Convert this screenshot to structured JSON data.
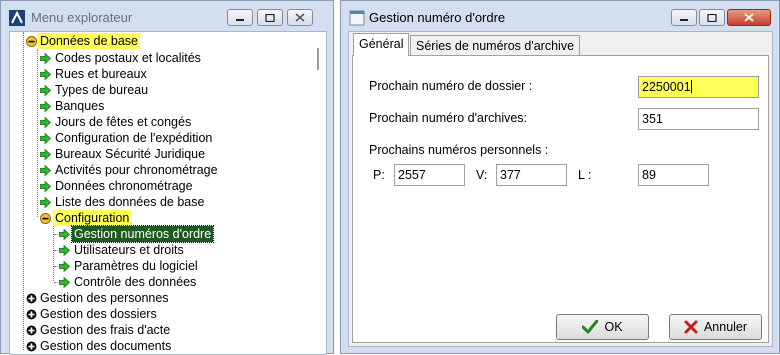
{
  "explorer": {
    "title": "Menu explorateur",
    "tree": {
      "donnees_de_base": "Données de base",
      "children": [
        "Codes postaux et localités",
        "Rues et bureaux",
        "Types de bureau",
        "Banques",
        "Jours de fêtes et congés",
        "Configuration de l'expédition",
        "Bureaux Sécurité Juridique",
        "Activités pour chronométrage",
        "Données chronométrage",
        "Liste des données de base"
      ],
      "configuration": "Configuration",
      "config_children": [
        "Gestion numéros d'ordre",
        "Utilisateurs et droits",
        "Paramètres du logiciel",
        "Contrôle des données"
      ],
      "top_level": [
        "Gestion des personnes",
        "Gestion des dossiers",
        "Gestion des frais d'acte",
        "Gestion des documents"
      ]
    }
  },
  "dialog": {
    "title": "Gestion numéro d'ordre",
    "tabs": [
      "Général",
      "Séries de numéros d'archive"
    ],
    "labels": {
      "dossier": "Prochain numéro de dossier :",
      "archives": "Prochain numéro d'archives:",
      "personnels": "Prochains numéros personnels :",
      "p": "P:",
      "v": "V:",
      "l": "L :"
    },
    "values": {
      "dossier": "2250001",
      "archives": "351",
      "p": "2557",
      "v": "377",
      "l": "89"
    },
    "buttons": {
      "ok": "OK",
      "cancel": "Annuler"
    }
  },
  "colors": {
    "highlight": "#ffff5a",
    "selection": "#1e5a1e",
    "arrow": "#2fb52f"
  }
}
